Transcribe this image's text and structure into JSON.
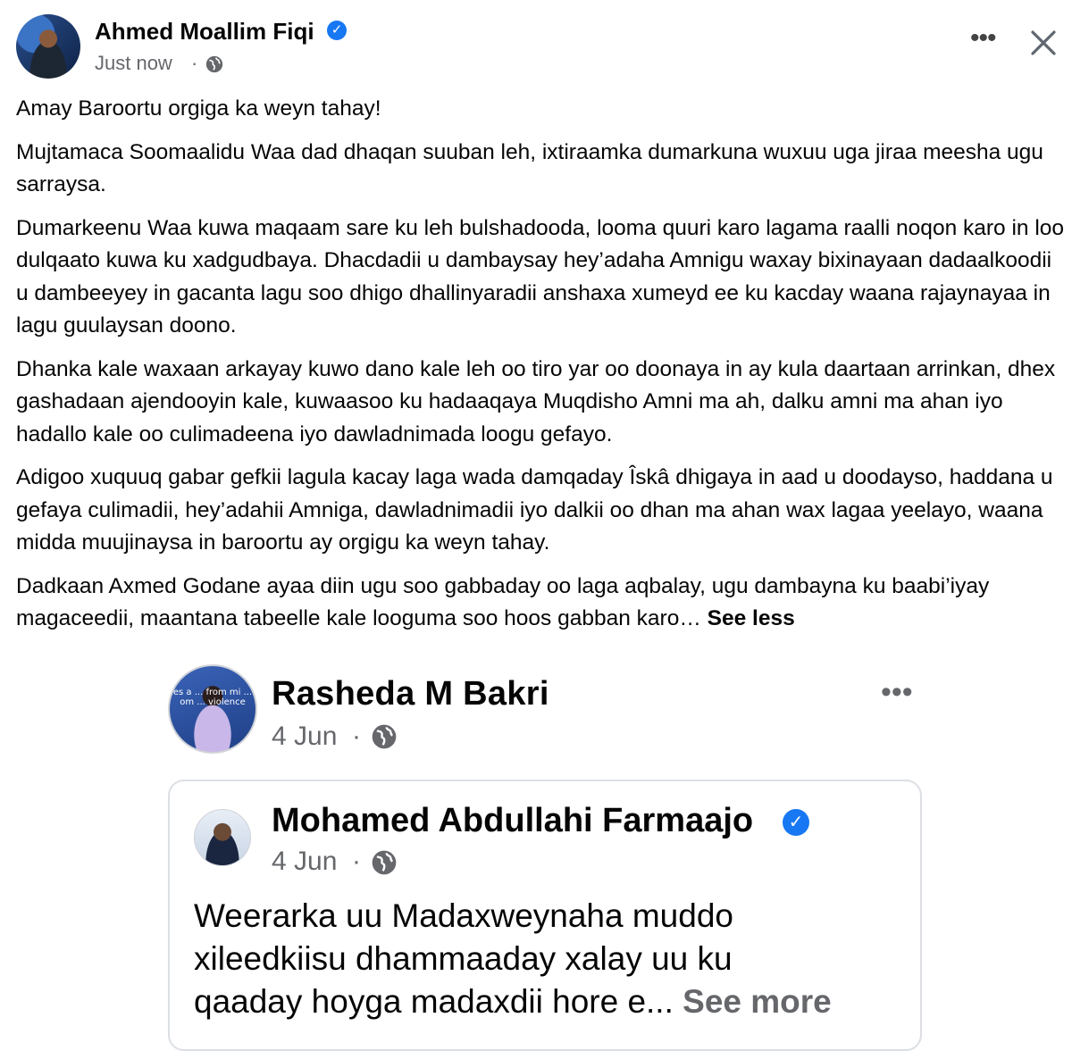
{
  "post": {
    "author": "Ahmed Moallim Fiqi",
    "verified_icon": "verified-check-icon",
    "timestamp": "Just now",
    "separator": "·",
    "privacy_icon": "globe-icon",
    "paragraphs": [
      "Amay Baroortu orgiga ka weyn tahay!",
      "Mujtamaca Soomaalidu Waa dad dhaqan suuban leh, ixtiraamka dumarkuna wuxuu uga jiraa meesha ugu sarraysa.",
      "Dumarkeenu Waa kuwa maqaam sare ku leh bulshadooda, looma quuri karo lagama raalli noqon karo in loo dulqaato kuwa ku xadgudbaya. Dhacdadii u dambaysay hey’adaha Amnigu waxay bixinayaan dadaalkoodii u dambeeyey in gacanta lagu soo dhigo dhallinyaradii anshaxa xumeyd ee ku kacday waana rajaynayaa in lagu guulaysan doono.",
      "Dhanka kale waxaan arkayay kuwo dano kale leh oo tiro yar oo doonaya in ay kula daartaan arrinkan, dhex gashadaan ajendooyin kale, kuwaasoo ku hadaaqaya Muqdisho Amni  ma ah, dalku amni ma ahan iyo hadallo kale oo culimadeena iyo dawladnimada loogu gefayo.",
      "Adigoo xuquuq gabar gefkii lagula kacay laga wada damqaday Îskâ dhigaya in aad u doodayso, haddana u gefaya culimadii, hey’adahii Amniga, dawladnimadii iyo dalkii oo dhan ma ahan wax lagaa yeelayo, waana midda muujinaysa in baroortu ay orgigu ka weyn tahay.",
      "Dadkaan Axmed Godane ayaa diin ugu soo gabbaday oo laga aqbalay, ugu dambayna ku baabi’iyay magaceedii, maantana tabeelle kale looguma soo hoos gabban karo…"
    ],
    "see_less": "See less",
    "more_icon": "more-options-icon",
    "close_icon": "close-icon"
  },
  "embedded": {
    "author": "Rasheda M Bakri",
    "avatar_banner": "es a ... from mi ... om ... violence",
    "timestamp": "4 Jun",
    "separator": "·",
    "shared": {
      "author": "Mohamed Abdullahi Farmaajo",
      "timestamp": "4 Jun",
      "separator": "·",
      "lines": [
        "Weerarka uu Madaxweynaha muddo",
        "xileedkiisu dhammaaday xalay uu ku",
        "qaaday hoyga madaxdii hore e..."
      ],
      "see_more": "See more"
    }
  },
  "colors": {
    "text": "#050505",
    "secondary": "#65676b",
    "verified": "#1877f2"
  }
}
